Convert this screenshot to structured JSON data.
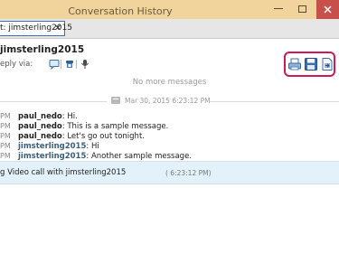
{
  "window": {
    "title": "Conversation History"
  },
  "tab": {
    "label": "t: jimsterling2015",
    "close_glyph": "✕"
  },
  "header": {
    "contact_name": "jimsterling2015",
    "reply_via_label": "eply via:",
    "reply_icons": [
      "chat-icon",
      "phone-icon",
      "microphone-icon"
    ],
    "actions": [
      "print-icon",
      "save-icon",
      "export-icon"
    ]
  },
  "messages_area": {
    "no_more_messages": "No more messages",
    "date_divider": "Mar 30, 2015 6:23:12 PM",
    "messages": [
      {
        "time": "PM",
        "sender": "paul_nedo",
        "type": "local",
        "text": ": Hi."
      },
      {
        "time": "PM",
        "sender": "paul_nedo",
        "type": "local",
        "text": ": This is a sample message."
      },
      {
        "time": "PM",
        "sender": "paul_nedo",
        "type": "local",
        "text": ": Let's go out tonight."
      },
      {
        "time": "PM",
        "sender": "jimsterling2015",
        "type": "remote",
        "text": ": Hi"
      },
      {
        "time": "PM",
        "sender": "jimsterling2015",
        "type": "remote",
        "text": ": Another sample message."
      }
    ],
    "call_notice": {
      "text": "g Video call with jimsterling2015",
      "time": "( 6:23:12 PM)"
    }
  },
  "colors": {
    "title_bar": "#f0d49c",
    "close_button": "#c7504a",
    "highlight": "#d0175a",
    "remote_sender": "#3a5f7e",
    "call_bar": "#e3f1fa"
  }
}
